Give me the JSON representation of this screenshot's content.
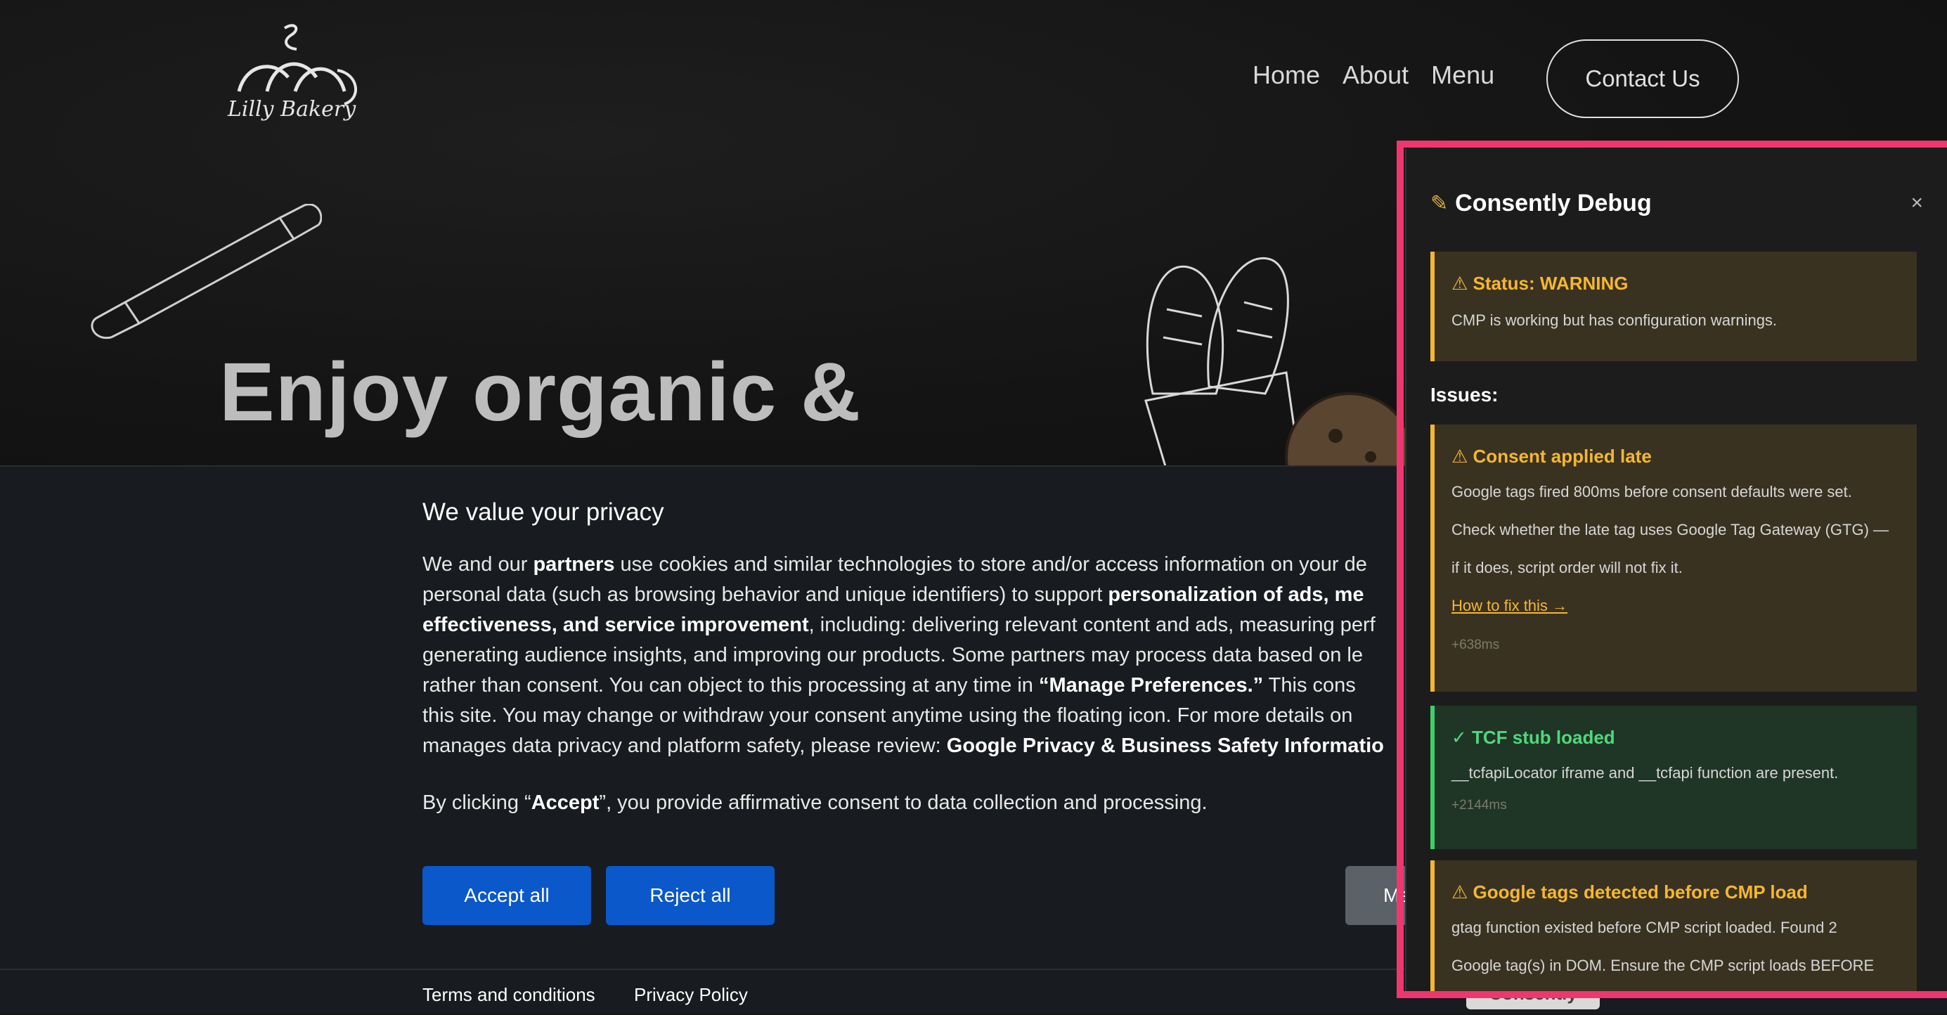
{
  "site": {
    "logo_text": "Lilly Bakery",
    "nav": [
      "Home",
      "About",
      "Menu"
    ],
    "contact_label": "Contact Us",
    "headline": "Enjoy organic &"
  },
  "consent": {
    "title": "We value your privacy",
    "paragraph_lines": [
      [
        {
          "t": "We and our "
        },
        {
          "t": "partners",
          "b": true
        },
        {
          "t": " use cookies and similar technologies to store and/or access information on your de"
        }
      ],
      [
        {
          "t": "personal data (such as browsing behavior and unique identifiers) to support "
        },
        {
          "t": "personalization of ads, me",
          "b": true
        }
      ],
      [
        {
          "t": "effectiveness, and service improvement",
          "b": true
        },
        {
          "t": ", including: delivering relevant content and ads, measuring perf"
        }
      ],
      [
        {
          "t": "generating audience insights, and improving our products. Some partners may process data based on le"
        }
      ],
      [
        {
          "t": "rather than consent. You can object to this processing at any time in "
        },
        {
          "t": "“Manage Preferences.”",
          "b": true
        },
        {
          "t": " This cons"
        }
      ],
      [
        {
          "t": "this site. You may change or withdraw your consent anytime using the floating icon. For more details on"
        }
      ],
      [
        {
          "t": "manages data privacy and platform safety, please review: "
        },
        {
          "t": "Google Privacy & Business Safety Informatio",
          "b": true
        }
      ]
    ],
    "line2": [
      {
        "t": "By clicking “"
      },
      {
        "t": "Accept",
        "b": true
      },
      {
        "t": "”, you provide affirmative consent to data collection and processing."
      }
    ],
    "accept_label": "Accept all",
    "reject_label": "Reject all",
    "manage_label": "Ma",
    "footer_terms": "Terms and conditions",
    "footer_privacy": "Privacy Policy",
    "badge": "Consently"
  },
  "debug": {
    "title": "Consently Debug",
    "close": "×",
    "status_head": "⚠ Status: WARNING",
    "status_text": "CMP is working but has configuration warnings.",
    "issues_label": "Issues:",
    "issues": [
      {
        "kind": "warn",
        "head": "⚠ Consent applied late",
        "lines": [
          "Google tags fired 800ms before consent defaults were set.",
          "Check whether the late tag uses Google Tag Gateway (GTG) —",
          "if it does, script order will not fix it."
        ],
        "link": "How to fix this →",
        "time": "+638ms"
      },
      {
        "kind": "ok",
        "head": "✓ TCF stub loaded",
        "lines": [
          "__tcfapiLocator iframe and __tcfapi function are present."
        ],
        "time": "+2144ms"
      },
      {
        "kind": "warn",
        "head": "⚠ Google tags detected before CMP load",
        "lines": [
          "gtag function existed before CMP script loaded. Found 2",
          "Google tag(s) in DOM. Ensure the CMP script loads BEFORE"
        ]
      }
    ]
  },
  "colors": {
    "accent_blue": "#0a58ca",
    "debug_border": "#f0366f",
    "warn": "#f5b731",
    "ok": "#3fcf6a"
  }
}
